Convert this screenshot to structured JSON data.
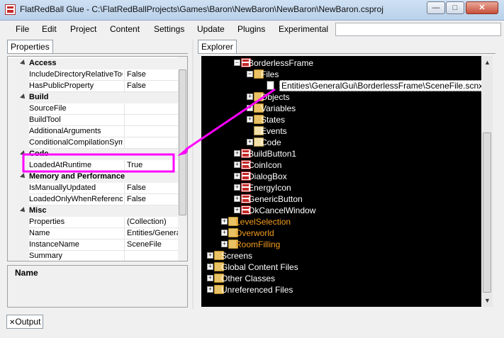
{
  "window": {
    "title": "FlatRedBall Glue - C:\\FlatRedBallProjects\\Games\\Baron\\NewBaron\\NewBaron\\NewBaron.csproj",
    "minimize_glyph": "—",
    "maximize_glyph": "□",
    "close_glyph": "✕"
  },
  "menu": [
    "File",
    "Edit",
    "Project",
    "Content",
    "Settings",
    "Update",
    "Plugins",
    "Experimental"
  ],
  "properties_panel": {
    "tab_label": "Properties",
    "categories": [
      {
        "name": "Access",
        "rows": [
          {
            "name": "IncludeDirectoryRelativeToC",
            "value": "False"
          },
          {
            "name": "HasPublicProperty",
            "value": "False"
          }
        ]
      },
      {
        "name": "Build",
        "rows": [
          {
            "name": "SourceFile",
            "value": ""
          },
          {
            "name": "BuildTool",
            "value": ""
          },
          {
            "name": "AdditionalArguments",
            "value": ""
          },
          {
            "name": "ConditionalCompilationSymb",
            "value": ""
          }
        ]
      },
      {
        "name": "Code",
        "rows": [
          {
            "name": "LoadedAtRuntime",
            "value": "True"
          }
        ]
      },
      {
        "name": "Memory and Performance",
        "rows": [
          {
            "name": "IsManuallyUpdated",
            "value": "False"
          },
          {
            "name": "LoadedOnlyWhenReference",
            "value": "False"
          }
        ]
      },
      {
        "name": "Misc",
        "rows": [
          {
            "name": "Properties",
            "value": "(Collection)"
          },
          {
            "name": "Name",
            "value": "Entities/Genera"
          },
          {
            "name": "InstanceName",
            "value": "SceneFile"
          },
          {
            "name": "Summary",
            "value": ""
          }
        ]
      }
    ],
    "description_title": "Name"
  },
  "explorer_panel": {
    "tab_label": "Explorer",
    "nodes": [
      {
        "label": "BorderlessFrame",
        "icon": "entity-icon",
        "expander": "-",
        "level": 2
      },
      {
        "label": "Files",
        "icon": "folder-icon",
        "expander": "-",
        "level": 3
      },
      {
        "label": "Entities\\GeneralGui\\BorderlessFrame\\SceneFile.scnx",
        "icon": "file-icon",
        "expander": "",
        "level": 4,
        "selected": true
      },
      {
        "label": "Objects",
        "icon": "folder-icon",
        "expander": "+",
        "level": 3
      },
      {
        "label": "Variables",
        "icon": "folder-icon",
        "expander": "+",
        "level": 3
      },
      {
        "label": "States",
        "icon": "folder-icon",
        "expander": "+",
        "level": 3
      },
      {
        "label": "Events",
        "icon": "events-icon",
        "expander": "",
        "level": 3
      },
      {
        "label": "Code",
        "icon": "code-icon",
        "expander": "+",
        "level": 3
      },
      {
        "label": "BuildButton1",
        "icon": "entity-icon",
        "expander": "+",
        "level": 2
      },
      {
        "label": "CoinIcon",
        "icon": "entity-icon",
        "expander": "+",
        "level": 2
      },
      {
        "label": "DialogBox",
        "icon": "entity-icon",
        "expander": "+",
        "level": 2
      },
      {
        "label": "EnergyIcon",
        "icon": "entity-icon",
        "expander": "+",
        "level": 2
      },
      {
        "label": "GenericButton",
        "icon": "entity-icon",
        "expander": "+",
        "level": 2
      },
      {
        "label": "OkCancelWindow",
        "icon": "entity-icon",
        "expander": "+",
        "level": 2
      },
      {
        "label": "LevelSelection",
        "icon": "folder-icon",
        "expander": "+",
        "level": 1,
        "color": "#f29c1f"
      },
      {
        "label": "Overworld",
        "icon": "folder-icon",
        "expander": "+",
        "level": 1,
        "color": "#f29c1f"
      },
      {
        "label": "RoomFilling",
        "icon": "folder-icon",
        "expander": "+",
        "level": 1,
        "color": "#f29c1f"
      },
      {
        "label": "Screens",
        "icon": "folder-icon",
        "expander": "+",
        "level": 0
      },
      {
        "label": "Global Content Files",
        "icon": "folder-icon",
        "expander": "+",
        "level": 0
      },
      {
        "label": "Other Classes",
        "icon": "folder-icon",
        "expander": "+",
        "level": 0
      },
      {
        "label": "Unreferenced Files",
        "icon": "folder-icon",
        "expander": "+",
        "level": 0
      }
    ]
  },
  "output_tab": {
    "close_glyph": "✕",
    "label": "Output"
  },
  "annotation": {
    "color": "#ff00ff"
  },
  "colors": {
    "tree_background": "#000000",
    "orange_folder_text": "#f29c1f",
    "annotation": "#ff00ff"
  }
}
